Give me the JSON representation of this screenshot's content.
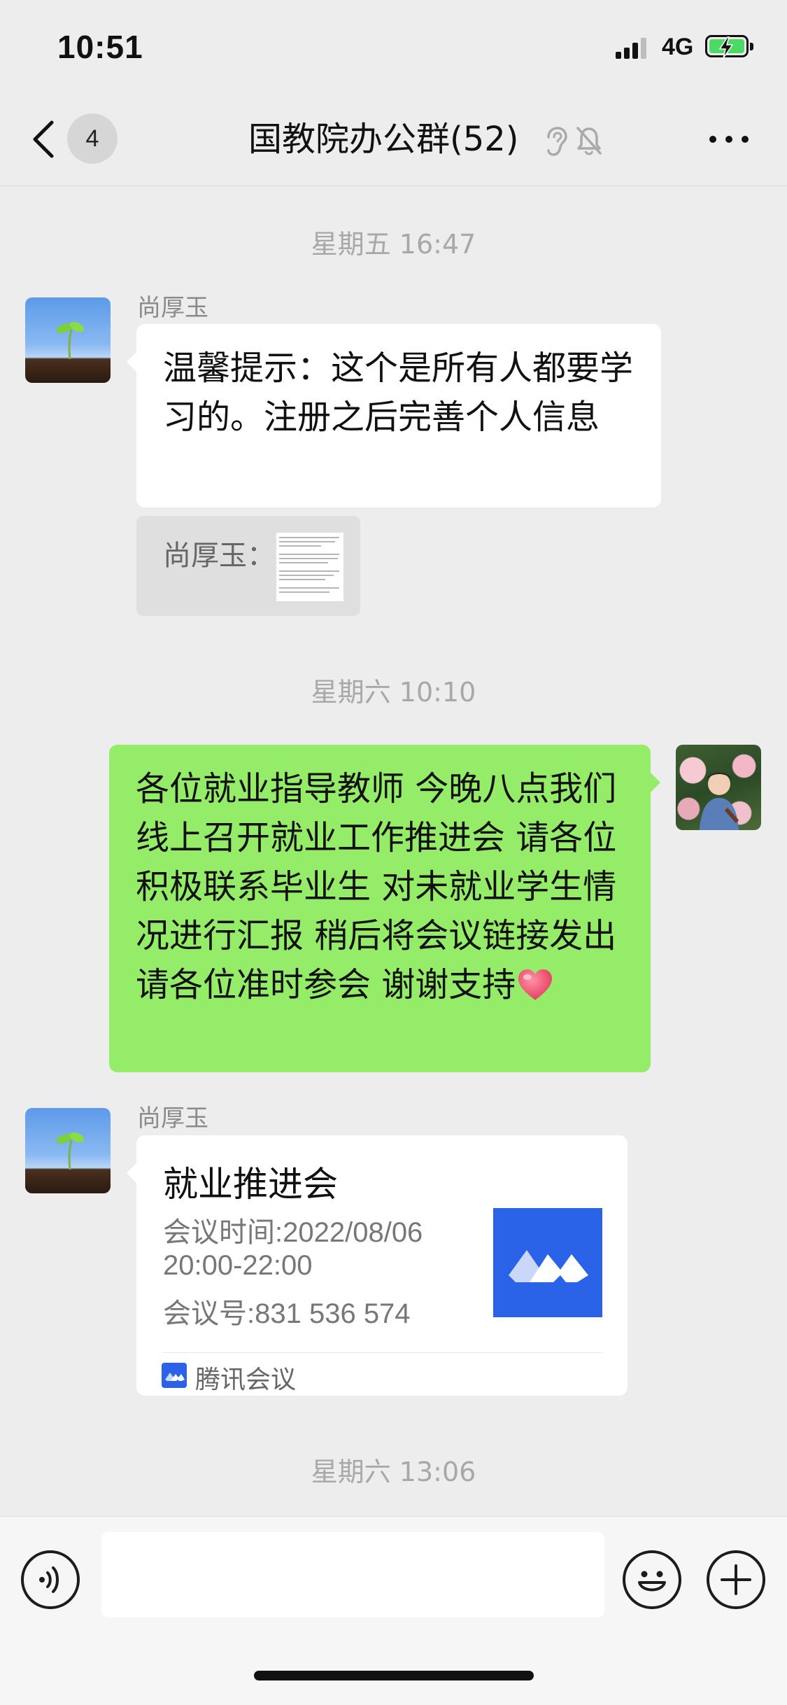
{
  "status_bar": {
    "time": "10:51",
    "network": "4G",
    "battery_charging": true
  },
  "nav": {
    "unread_count": "4",
    "title": "国教院办公群(52)",
    "icons": [
      "back-icon",
      "ear-icon",
      "mute-bell-icon",
      "more-icon"
    ]
  },
  "chat": {
    "timestamps": [
      "星期五 16:47",
      "星期六 10:10",
      "星期六 13:06"
    ],
    "messages": [
      {
        "sender": "尚厚玉",
        "text": "温馨提示：这个是所有人都要学习的。注册之后完善个人信息",
        "quote_label": "尚厚玉："
      },
      {
        "sender": "",
        "text": "各位就业指导教师 今晚八点我们线上召开就业工作推进会 请各位积极联系毕业生 对未就业学生情况进行汇报 稍后将会议链接发出 请各位准时参会 谢谢支持",
        "emoji": "heart"
      },
      {
        "sender": "尚厚玉",
        "card": {
          "title": "就业推进会",
          "time_label": "会议时间:2022/08/06",
          "time_range": "20:00-22:00",
          "meeting_id": "会议号:831 536 574",
          "app_name": "腾讯会议"
        }
      }
    ]
  },
  "input_bar": {
    "icons": [
      "voice-icon",
      "emoji-icon",
      "plus-icon"
    ],
    "text_value": ""
  },
  "colors": {
    "background": "#ededed",
    "bubble_self": "#95ec69",
    "bubble_other": "#ffffff",
    "meeting_brand": "#2b63e8"
  }
}
